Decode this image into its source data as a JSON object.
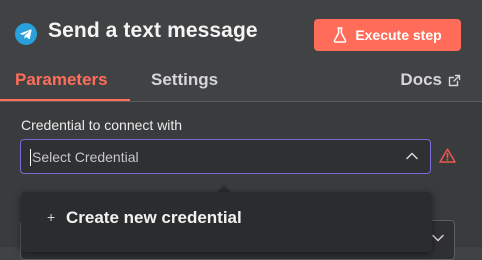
{
  "header": {
    "title": "Send a text message",
    "node_icon": "telegram-icon",
    "execute_button": {
      "label": "Execute step",
      "icon": "flask-icon",
      "color": "#ff6d5a"
    }
  },
  "tabs": [
    {
      "label": "Parameters",
      "active": true
    },
    {
      "label": "Settings",
      "active": false
    },
    {
      "label": "Docs",
      "icon": "external-link-icon"
    }
  ],
  "credential": {
    "label": "Credential to connect with",
    "placeholder": "Select Credential",
    "chevron_icon": "chevron-up-icon",
    "warning_icon": "warning-icon"
  },
  "dropdown": {
    "items": [
      {
        "icon": "plus-icon",
        "plus_glyph": "+",
        "label": "Create new credential"
      }
    ]
  },
  "colors": {
    "accent": "#ff6d5a",
    "focus_border": "#7b68d9",
    "warning": "#f2564a"
  }
}
